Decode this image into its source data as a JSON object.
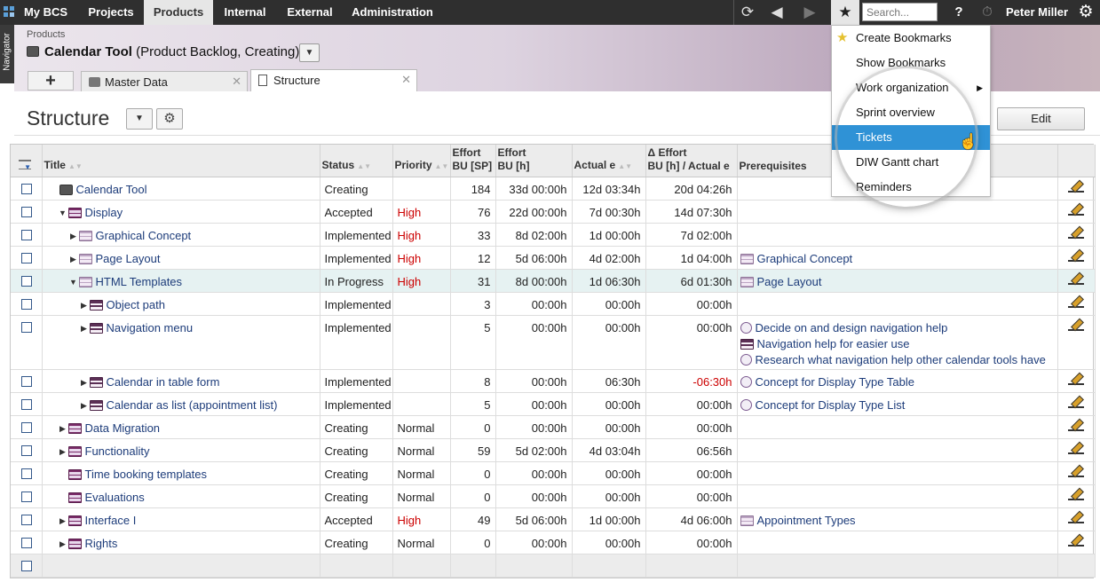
{
  "topnav": {
    "items": [
      {
        "label": "My BCS"
      },
      {
        "label": "Projects"
      },
      {
        "label": "Products"
      },
      {
        "label": "Internal"
      },
      {
        "label": "External"
      },
      {
        "label": "Administration"
      }
    ],
    "active": "Products",
    "search_placeholder": "Search...",
    "help": "?",
    "user": "Peter Miller"
  },
  "navigator": {
    "label": "Navigator"
  },
  "header": {
    "breadcrumb": "Products",
    "object_name": "Calendar Tool",
    "object_suffix": "(Product Backlog, Creating)"
  },
  "tabs": [
    {
      "label": "Master Data"
    },
    {
      "label": "Structure"
    }
  ],
  "page": {
    "title": "Structure",
    "edit_label": "Edit"
  },
  "table": {
    "columns": {
      "title": "Title",
      "status": "Status",
      "priority": "Priority",
      "effort_sp_1": "Effort",
      "effort_sp_2": "BU [SP]",
      "effort_h_1": "Effort",
      "effort_h_2": "BU [h]",
      "actual": "Actual e",
      "delta_1": "Δ Effort",
      "delta_2": "BU [h] / Actual e",
      "prereq": "Prerequisites"
    },
    "rows": [
      {
        "title": "Calendar Tool",
        "status": "Creating",
        "priority": "",
        "sp": "184",
        "bu": "33d 00:00h",
        "actual": "12d 03:34h",
        "delta": "20d 04:26h",
        "prereq": []
      },
      {
        "title": "Display",
        "status": "Accepted",
        "priority": "High",
        "sp": "76",
        "bu": "22d 00:00h",
        "actual": "7d 00:30h",
        "delta": "14d 07:30h",
        "prereq": []
      },
      {
        "title": "Graphical Concept",
        "status": "Implemented",
        "priority": "High",
        "sp": "33",
        "bu": "8d 02:00h",
        "actual": "1d 00:00h",
        "delta": "7d 02:00h",
        "prereq": []
      },
      {
        "title": "Page Layout",
        "status": "Implemented",
        "priority": "High",
        "sp": "12",
        "bu": "5d 06:00h",
        "actual": "4d 02:00h",
        "delta": "1d 04:00h",
        "prereq": [
          "Graphical Concept"
        ]
      },
      {
        "title": "HTML Templates",
        "status": "In Progress",
        "priority": "High",
        "sp": "31",
        "bu": "8d 00:00h",
        "actual": "1d 06:30h",
        "delta": "6d 01:30h",
        "prereq": [
          "Page Layout"
        ]
      },
      {
        "title": "Object path",
        "status": "Implemented",
        "priority": "",
        "sp": "3",
        "bu": "00:00h",
        "actual": "00:00h",
        "delta": "00:00h",
        "prereq": []
      },
      {
        "title": "Navigation menu",
        "status": "Implemented",
        "priority": "",
        "sp": "5",
        "bu": "00:00h",
        "actual": "00:00h",
        "delta": "00:00h",
        "prereq": [
          "Decide on and design navigation help",
          "Navigation help for easier use",
          "Research what navigation help other calendar tools have"
        ]
      },
      {
        "title": "Calendar in table form",
        "status": "Implemented",
        "priority": "",
        "sp": "8",
        "bu": "00:00h",
        "actual": "06:30h",
        "delta": "-06:30h",
        "prereq": [
          "Concept for Display Type Table"
        ]
      },
      {
        "title": "Calendar as list (appointment list)",
        "status": "Implemented",
        "priority": "",
        "sp": "5",
        "bu": "00:00h",
        "actual": "00:00h",
        "delta": "00:00h",
        "prereq": [
          "Concept for Display Type List"
        ]
      },
      {
        "title": "Data Migration",
        "status": "Creating",
        "priority": "Normal",
        "sp": "0",
        "bu": "00:00h",
        "actual": "00:00h",
        "delta": "00:00h",
        "prereq": []
      },
      {
        "title": "Functionality",
        "status": "Creating",
        "priority": "Normal",
        "sp": "59",
        "bu": "5d 02:00h",
        "actual": "4d 03:04h",
        "delta": "06:56h",
        "prereq": []
      },
      {
        "title": "Time booking templates",
        "status": "Creating",
        "priority": "Normal",
        "sp": "0",
        "bu": "00:00h",
        "actual": "00:00h",
        "delta": "00:00h",
        "prereq": []
      },
      {
        "title": "Evaluations",
        "status": "Creating",
        "priority": "Normal",
        "sp": "0",
        "bu": "00:00h",
        "actual": "00:00h",
        "delta": "00:00h",
        "prereq": []
      },
      {
        "title": "Interface I",
        "status": "Accepted",
        "priority": "High",
        "sp": "49",
        "bu": "5d 06:00h",
        "actual": "1d 00:00h",
        "delta": "4d 06:00h",
        "prereq": [
          "Appointment Types"
        ]
      },
      {
        "title": "Rights",
        "status": "Creating",
        "priority": "Normal",
        "sp": "0",
        "bu": "00:00h",
        "actual": "00:00h",
        "delta": "00:00h",
        "prereq": []
      }
    ]
  },
  "bookmark_menu": {
    "items": [
      {
        "label": "Create Bookmarks"
      },
      {
        "label": "Show Bookmarks"
      },
      {
        "label": "Work organization"
      },
      {
        "label": "Sprint overview"
      },
      {
        "label": "Tickets"
      },
      {
        "label": "DIW Gantt chart"
      },
      {
        "label": "Reminders"
      }
    ],
    "highlighted": "Tickets"
  },
  "colors": {
    "accent": "#2f92d6",
    "topbar": "#2f2f2f",
    "link": "#1d3c7a",
    "high": "#cc0000",
    "negative": "#cc0000"
  }
}
